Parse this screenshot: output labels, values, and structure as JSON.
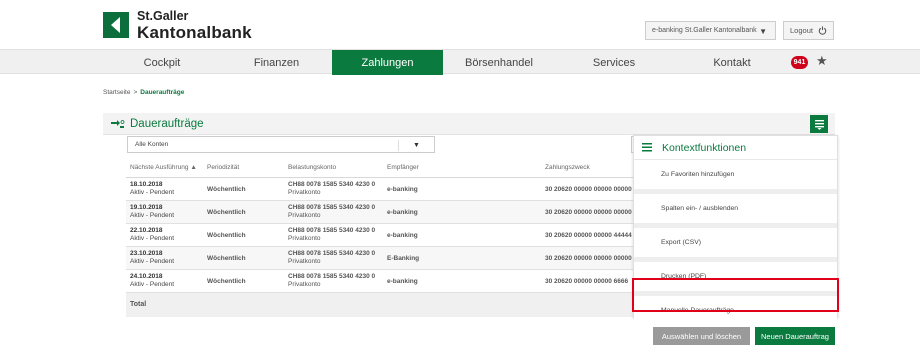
{
  "brand": {
    "line1": "St.Galler",
    "line2": "Kantonalbank",
    "accent": "#0a7a3f"
  },
  "header": {
    "ebanking_select": "e-banking St.Galler Kantonalbank",
    "logout_label": "Logout"
  },
  "nav": {
    "items": [
      {
        "label": "Cockpit"
      },
      {
        "label": "Finanzen"
      },
      {
        "label": "Zahlungen"
      },
      {
        "label": "Börsenhandel"
      },
      {
        "label": "Services"
      },
      {
        "label": "Kontakt"
      }
    ],
    "active": "Zahlungen",
    "badge": "941"
  },
  "breadcrumb": {
    "home": "Startseite",
    "separator": ">",
    "current": "Daueraufträge"
  },
  "panel": {
    "title": "Daueraufträge",
    "filter_value": "Alle Konten",
    "columns": [
      "Nächste Ausführung ▲",
      "Periodizität",
      "Belastungskonto",
      "Empfänger",
      "Zahlungszweck"
    ],
    "rows": [
      {
        "date": "18.10.2018",
        "status": "Aktiv - Pendent",
        "periodicity": "Wöchentlich",
        "account": "CH88 0078 1585 5340 4230 0",
        "account_type": "Privatkonto",
        "recipient": "e-banking",
        "purpose": "30 20620 00000 00000 00000"
      },
      {
        "date": "19.10.2018",
        "status": "Aktiv - Pendent",
        "periodicity": "Wöchentlich",
        "account": "CH88 0078 1585 5340 4230 0",
        "account_type": "Privatkonto",
        "recipient": "e-banking",
        "purpose": "30 20620 00000 00000 00000"
      },
      {
        "date": "22.10.2018",
        "status": "Aktiv - Pendent",
        "periodicity": "Wöchentlich",
        "account": "CH88 0078 1585 5340 4230 0",
        "account_type": "Privatkonto",
        "recipient": "e-banking",
        "purpose": "30 20620 00000 00000 44444"
      },
      {
        "date": "23.10.2018",
        "status": "Aktiv - Pendent",
        "periodicity": "Wöchentlich",
        "account": "CH88 0078 1585 5340 4230 0",
        "account_type": "Privatkonto",
        "recipient": "E-Banking",
        "purpose": "30 20620 00000 00000 00000"
      },
      {
        "date": "24.10.2018",
        "status": "Aktiv - Pendent",
        "periodicity": "Wöchentlich",
        "account": "CH88 0078 1585 5340 4230 0",
        "account_type": "Privatkonto",
        "recipient": "e-banking",
        "purpose": "30 20620 00000 00000 6666"
      }
    ],
    "total_label": "Total",
    "btn_select_delete": "Auswählen und löschen",
    "btn_new": "Neuen Dauerauftrag"
  },
  "context_menu": {
    "title": "Kontextfunktionen",
    "items": [
      {
        "label": "Zu Favoriten hinzufügen"
      },
      {
        "label": "Spalten ein- / ausblenden"
      },
      {
        "label": "Export (CSV)"
      },
      {
        "label": "Drucken (PDF)"
      },
      {
        "label": "Manuelle Daueraufträge"
      }
    ],
    "highlight_color": "#e1001a"
  }
}
